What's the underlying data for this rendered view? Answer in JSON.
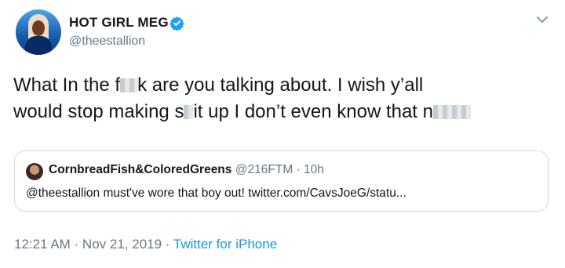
{
  "user": {
    "display_name": "HOT GIRL MEG",
    "handle": "@theestallion"
  },
  "tweet": {
    "line1_a": "What In the f",
    "line1_b": "k are you talking about. I wish y’all",
    "line2_a": "would stop making s",
    "line2_b": "it up I don’t even know that n"
  },
  "quoted": {
    "name": "CornbreadFish&ColoredGreens",
    "handle": "@216FTM",
    "separator": " · ",
    "age": "10h",
    "text": "@theestallion must've wore that boy out! twitter.com/CavsJoeG/statu..."
  },
  "footer": {
    "timestamp": "12:21 AM · Nov 21, 2019",
    "separator": " · ",
    "source": "Twitter for iPhone"
  },
  "colors": {
    "accent": "#1b95e0",
    "verified": "#1da1f2",
    "muted_text": "#657786",
    "border": "#cfd9de"
  },
  "icons": {
    "verified": "verified-badge-icon",
    "menu": "chevron-down-icon"
  }
}
